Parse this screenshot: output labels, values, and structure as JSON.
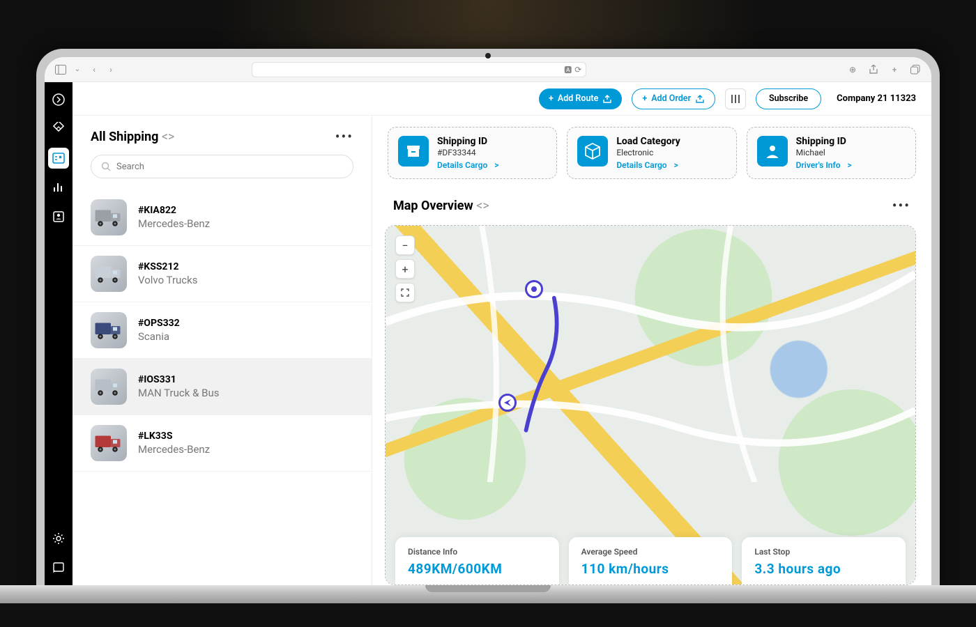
{
  "topbar": {
    "add_route_label": "Add Route",
    "add_order_label": "Add Order",
    "subscribe_label": "Subscribe",
    "company_label": "Company 21 11323"
  },
  "search": {
    "placeholder": "Search"
  },
  "sections": {
    "all_shipping_title": "All Shipping",
    "map_overview_title": "Map Overview"
  },
  "shipping_list": [
    {
      "id": "#KIA822",
      "make": "Mercedes-Benz",
      "tint": "#9aa0a6"
    },
    {
      "id": "#KSS212",
      "make": "Volvo Trucks",
      "tint": "#c9cfd6"
    },
    {
      "id": "#OPS332",
      "make": "Scania",
      "tint": "#3a4a7a"
    },
    {
      "id": "#IOS331",
      "make": "MAN Truck & Bus",
      "tint": "#b8bec6",
      "selected": true
    },
    {
      "id": "#LK33S",
      "make": "Mercedes-Benz",
      "tint": "#b43a3a"
    }
  ],
  "info_cards": [
    {
      "title": "Shipping ID",
      "sub": "#DF33344",
      "link": "Details Cargo",
      "icon": "archive"
    },
    {
      "title": "Load Category",
      "sub": "Electronic",
      "link": "Details Cargo",
      "icon": "package"
    },
    {
      "title": "Shipping ID",
      "sub": "Michael",
      "link": "Driver's Info",
      "icon": "user"
    }
  ],
  "map_stats": [
    {
      "label": "Distance Info",
      "value": "489KM/600KM"
    },
    {
      "label": "Average Speed",
      "value": "110 km/hours"
    },
    {
      "label": "Last Stop",
      "value": "3.3 hours ago"
    }
  ],
  "chev_symbol": "<>"
}
